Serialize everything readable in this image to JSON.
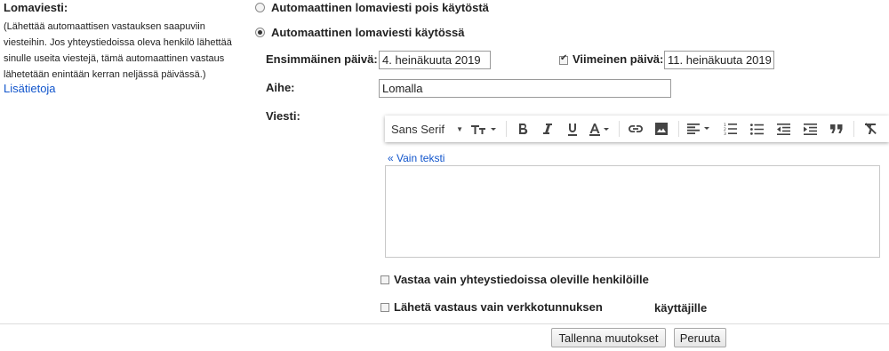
{
  "left": {
    "title": "Lomaviesti:",
    "description": "(Lähettää automaattisen vastauksen saapuviin viesteihin. Jos yhteystiedoissa oleva henkilö lähettää sinulle useita viestejä, tämä automaattinen vastaus lähetetään enintään kerran neljässä päivässä.)",
    "more_link": "Lisätietoja"
  },
  "options": {
    "off_label": "Automaattinen lomaviesti pois käytöstä",
    "on_label": "Automaattinen lomaviesti käytössä",
    "selected": "on"
  },
  "dates": {
    "first_day_label": "Ensimmäinen päivä:",
    "first_day_value": "4. heinäkuuta 2019",
    "last_day_label": "Viimeinen päivä:",
    "last_day_value": "11. heinäkuuta 2019",
    "last_day_checked": true
  },
  "subject": {
    "label": "Aihe:",
    "value": "Lomalla"
  },
  "message": {
    "label": "Viesti:",
    "plain_text_link": "« Vain teksti",
    "body": ""
  },
  "toolbar": {
    "font_name": "Sans Serif",
    "icons": [
      "text-size-icon",
      "bold-icon",
      "italic-icon",
      "underline-icon",
      "text-color-icon",
      "link-icon",
      "image-icon",
      "align-icon",
      "numbered-list-icon",
      "bulleted-list-icon",
      "indent-less-icon",
      "indent-more-icon",
      "quote-icon",
      "remove-formatting-icon"
    ]
  },
  "restrictions": {
    "contacts_only_label": "Vastaa vain yhteystiedoissa oleville henkilöille",
    "domain_only_label": "Lähetä vastaus vain verkkotunnuksen",
    "domain_only_suffix": "käyttäjille",
    "contacts_only_checked": false,
    "domain_only_checked": false
  },
  "actions": {
    "save_label": "Tallenna muutokset",
    "cancel_label": "Peruuta"
  },
  "colors": {
    "link": "#1155cc",
    "text": "#222222",
    "border": "#9a9a9a"
  }
}
